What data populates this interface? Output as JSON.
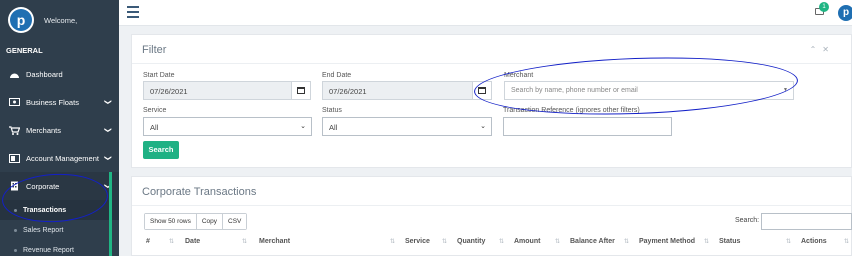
{
  "sidebar": {
    "welcome": "Welcome,",
    "logo_letter": "p",
    "section": "GENERAL",
    "items": [
      {
        "label": "Dashboard",
        "icon": "dashboard-icon",
        "chevron": ""
      },
      {
        "label": "Business Floats",
        "icon": "money-icon",
        "chevron": "❯"
      },
      {
        "label": "Merchants",
        "icon": "cart-icon",
        "chevron": "❯"
      },
      {
        "label": "Account Management",
        "icon": "user-cog-icon",
        "chevron": "❯"
      },
      {
        "label": "Corporate",
        "icon": "building-icon",
        "chevron": "❯"
      }
    ],
    "subitems": [
      {
        "label": "Transactions"
      },
      {
        "label": "Sales Report"
      },
      {
        "label": "Revenue Report"
      }
    ]
  },
  "topbar": {
    "notification_count": "1",
    "avatar_letter": "p"
  },
  "filter": {
    "title": "Filter",
    "start_date_label": "Start Date",
    "start_date_value": "07/26/2021",
    "end_date_label": "End Date",
    "end_date_value": "07/26/2021",
    "merchant_label": "Merchant",
    "merchant_placeholder": "Search by name, phone number or email",
    "service_label": "Service",
    "service_value": "All",
    "status_label": "Status",
    "status_value": "All",
    "txref_label": "Transaction Reference (ignores other filters)",
    "search_button": "Search"
  },
  "transactions": {
    "title": "Corporate Transactions",
    "buttons": [
      "Show 50 rows",
      "Copy",
      "CSV"
    ],
    "search_label": "Search:",
    "columns": [
      "#",
      "Date",
      "Merchant",
      "Service",
      "Quantity",
      "Amount",
      "Balance After",
      "Payment Method",
      "Status",
      "Actions"
    ]
  },
  "colors": {
    "sidebar": "#2f3e4c",
    "accent": "#1fb184",
    "annotation": "#1320c7"
  }
}
